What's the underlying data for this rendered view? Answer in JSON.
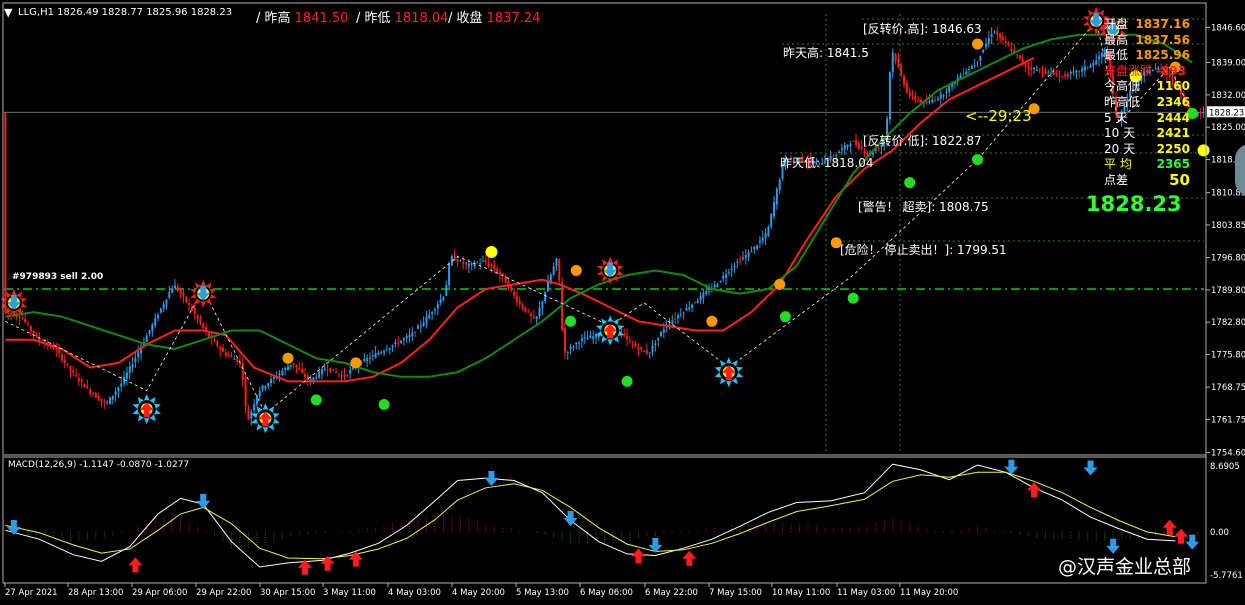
{
  "header": {
    "symbol_line": "LLG,H1  1826.49 1828.77 1825.96 1828.23",
    "top_labels": [
      {
        "text": "/ 昨高",
        "value": "1841.50"
      },
      {
        "text": "/ 昨低",
        "value": "1818.04"
      },
      {
        "text": "/ 收盘",
        "value": "1837.24"
      }
    ]
  },
  "chart_data": {
    "type": "candlestick",
    "timeframe": "H1",
    "ylim": [
      1754.5,
      1849.5
    ],
    "y_ticks": [
      1846.6,
      1839.0,
      1832.0,
      1825.0,
      1818.0,
      1810.85,
      1803.85,
      1796.8,
      1789.8,
      1782.8,
      1775.8,
      1768.75,
      1761.75,
      1754.6
    ],
    "current_price": "1828.23",
    "x_labels": [
      "27 Apr 2021",
      "28 Apr 13:00",
      "29 Apr 06:00",
      "29 Apr 22:00",
      "30 Apr 15:00",
      "3 May 11:00",
      "4 May 03:00",
      "4 May 20:00",
      "5 May 13:00",
      "6 May 06:00",
      "6 May 22:00",
      "7 May 15:00",
      "10 May 11:00",
      "11 May 03:00",
      "11 May 20:00"
    ],
    "price_path": [
      [
        0,
        1785
      ],
      [
        6,
        1784
      ],
      [
        12,
        1779
      ],
      [
        18,
        1777
      ],
      [
        24,
        1772
      ],
      [
        30,
        1768
      ],
      [
        36,
        1765
      ],
      [
        42,
        1770
      ],
      [
        48,
        1777
      ],
      [
        54,
        1784
      ],
      [
        60,
        1791
      ],
      [
        66,
        1786
      ],
      [
        72,
        1780
      ],
      [
        78,
        1776
      ],
      [
        84,
        1774
      ],
      [
        86,
        1761
      ],
      [
        90,
        1768
      ],
      [
        96,
        1771
      ],
      [
        102,
        1774
      ],
      [
        108,
        1770
      ],
      [
        114,
        1773
      ],
      [
        120,
        1771
      ],
      [
        126,
        1774
      ],
      [
        132,
        1776
      ],
      [
        138,
        1778
      ],
      [
        144,
        1780
      ],
      [
        150,
        1784
      ],
      [
        156,
        1789
      ],
      [
        158,
        1797
      ],
      [
        164,
        1795
      ],
      [
        170,
        1796
      ],
      [
        176,
        1793
      ],
      [
        182,
        1787
      ],
      [
        188,
        1783
      ],
      [
        194,
        1794
      ],
      [
        196,
        1797
      ],
      [
        198,
        1776
      ],
      [
        204,
        1779
      ],
      [
        210,
        1780
      ],
      [
        216,
        1782
      ],
      [
        222,
        1778
      ],
      [
        228,
        1776
      ],
      [
        234,
        1782
      ],
      [
        240,
        1785
      ],
      [
        246,
        1788
      ],
      [
        252,
        1791
      ],
      [
        258,
        1795
      ],
      [
        264,
        1798
      ],
      [
        270,
        1802
      ],
      [
        276,
        1818
      ],
      [
        282,
        1818
      ],
      [
        288,
        1817
      ],
      [
        294,
        1819
      ],
      [
        300,
        1822
      ],
      [
        306,
        1819
      ],
      [
        312,
        1822
      ],
      [
        314,
        1842
      ],
      [
        320,
        1832
      ],
      [
        326,
        1830
      ],
      [
        332,
        1832
      ],
      [
        338,
        1836
      ],
      [
        344,
        1839
      ],
      [
        350,
        1846
      ],
      [
        356,
        1842
      ],
      [
        362,
        1838
      ],
      [
        368,
        1837
      ],
      [
        374,
        1836
      ],
      [
        380,
        1837
      ],
      [
        386,
        1839
      ],
      [
        390,
        1842
      ],
      [
        394,
        1826
      ],
      [
        398,
        1832
      ],
      [
        404,
        1837
      ],
      [
        410,
        1838
      ],
      [
        416,
        1833
      ],
      [
        420,
        1828
      ]
    ],
    "series": [
      {
        "name": "",
        "color": "#ff2020",
        "values": [
          [
            0,
            1779
          ],
          [
            10,
            1779
          ],
          [
            20,
            1777
          ],
          [
            30,
            1773
          ],
          [
            40,
            1774
          ],
          [
            50,
            1778
          ],
          [
            60,
            1781
          ],
          [
            70,
            1781
          ],
          [
            78,
            1780
          ],
          [
            88,
            1773
          ],
          [
            100,
            1770
          ],
          [
            110,
            1770
          ],
          [
            120,
            1770
          ],
          [
            130,
            1771
          ],
          [
            140,
            1774
          ],
          [
            150,
            1779
          ],
          [
            160,
            1786
          ],
          [
            170,
            1790
          ],
          [
            180,
            1791
          ],
          [
            190,
            1792
          ],
          [
            196,
            1791
          ],
          [
            204,
            1789
          ],
          [
            214,
            1786
          ],
          [
            224,
            1783
          ],
          [
            234,
            1782
          ],
          [
            244,
            1781
          ],
          [
            254,
            1781
          ],
          [
            264,
            1785
          ],
          [
            274,
            1791
          ],
          [
            284,
            1801
          ],
          [
            294,
            1810
          ],
          [
            304,
            1816
          ],
          [
            314,
            1820
          ],
          [
            324,
            1826
          ],
          [
            334,
            1831
          ],
          [
            344,
            1834
          ],
          [
            354,
            1837
          ],
          [
            364,
            1840
          ]
        ]
      },
      {
        "name": "",
        "color": "#118a11",
        "values": [
          [
            0,
            1784
          ],
          [
            10,
            1785
          ],
          [
            20,
            1784
          ],
          [
            30,
            1782
          ],
          [
            40,
            1780
          ],
          [
            50,
            1778
          ],
          [
            60,
            1777
          ],
          [
            70,
            1779
          ],
          [
            80,
            1781
          ],
          [
            90,
            1781
          ],
          [
            100,
            1778
          ],
          [
            110,
            1775
          ],
          [
            120,
            1774
          ],
          [
            130,
            1772
          ],
          [
            140,
            1771
          ],
          [
            150,
            1771
          ],
          [
            160,
            1772
          ],
          [
            170,
            1775
          ],
          [
            180,
            1779
          ],
          [
            190,
            1783
          ],
          [
            200,
            1788
          ],
          [
            210,
            1791
          ],
          [
            220,
            1793
          ],
          [
            230,
            1794
          ],
          [
            240,
            1793
          ],
          [
            250,
            1790
          ],
          [
            260,
            1789
          ],
          [
            270,
            1790
          ],
          [
            280,
            1795
          ],
          [
            290,
            1805
          ],
          [
            300,
            1815
          ],
          [
            310,
            1822
          ],
          [
            320,
            1828
          ],
          [
            330,
            1833
          ],
          [
            340,
            1836
          ],
          [
            350,
            1839
          ],
          [
            360,
            1842
          ],
          [
            370,
            1844
          ],
          [
            380,
            1845
          ],
          [
            390,
            1845
          ],
          [
            400,
            1845
          ],
          [
            410,
            1843
          ],
          [
            420,
            1839
          ]
        ]
      }
    ],
    "horizontal_levels": [
      {
        "label": "[反转价.高]",
        "value": "1846.63"
      },
      {
        "label": "昨天高",
        "value": "1841.5"
      },
      {
        "label": "[反转价.低]",
        "value": "1822.87"
      },
      {
        "label": "昨天低",
        "value": "1818.04"
      },
      {
        "label": "[警告！ 超卖]",
        "value": "1808.75"
      },
      {
        "label": "[危险！ 停止卖出！]",
        "value": "1799.51"
      }
    ],
    "trade_line": {
      "label": "#979893 sell 2.00",
      "value": 1790
    },
    "countdown": "<--29:23",
    "signals": {
      "arrows_up": [
        [
          50,
          1764
        ],
        [
          92,
          1762
        ],
        [
          214,
          1781
        ],
        [
          256,
          1772
        ]
      ],
      "arrows_down": [
        [
          3,
          1787
        ],
        [
          70,
          1789
        ],
        [
          214,
          1794
        ],
        [
          386,
          1848
        ],
        [
          392,
          1846
        ]
      ],
      "orange_dots": [
        [
          100,
          1775
        ],
        [
          124,
          1774
        ],
        [
          202,
          1794
        ],
        [
          250,
          1783
        ],
        [
          274,
          1791
        ],
        [
          294,
          1800
        ],
        [
          344,
          1843
        ],
        [
          364,
          1829
        ],
        [
          414,
          1838
        ]
      ],
      "green_dots": [
        [
          110,
          1766
        ],
        [
          134,
          1765
        ],
        [
          200,
          1783
        ],
        [
          220,
          1770
        ],
        [
          276,
          1784
        ],
        [
          300,
          1788
        ],
        [
          320,
          1813
        ],
        [
          344,
          1818
        ],
        [
          420,
          1828
        ]
      ],
      "yellow_dots": [
        [
          172,
          1798
        ],
        [
          400,
          1836
        ],
        [
          424,
          1820
        ]
      ]
    },
    "macd": {
      "label": "MACD(12,26,9) -1.1147 -0.0870 -1.0277",
      "ylim": [
        -5.7761,
        8.6905
      ],
      "y_ticks": [
        "8.6905",
        "0.00",
        "-5.7761"
      ],
      "main_line": [
        [
          0,
          0.2
        ],
        [
          12,
          -0.9
        ],
        [
          24,
          -2.8
        ],
        [
          34,
          -3.6
        ],
        [
          44,
          -1.8
        ],
        [
          54,
          2.2
        ],
        [
          62,
          4.1
        ],
        [
          70,
          3.4
        ],
        [
          80,
          -1.2
        ],
        [
          90,
          -4.3
        ],
        [
          100,
          -3.8
        ],
        [
          112,
          -3.5
        ],
        [
          122,
          -2.6
        ],
        [
          132,
          -1.4
        ],
        [
          142,
          0.8
        ],
        [
          152,
          3.8
        ],
        [
          160,
          6.3
        ],
        [
          170,
          6.6
        ],
        [
          180,
          6.3
        ],
        [
          190,
          4.8
        ],
        [
          200,
          1.4
        ],
        [
          210,
          -1.2
        ],
        [
          220,
          -2.7
        ],
        [
          230,
          -2.9
        ],
        [
          240,
          -2.0
        ],
        [
          250,
          -0.9
        ],
        [
          260,
          0.7
        ],
        [
          270,
          2.4
        ],
        [
          280,
          3.6
        ],
        [
          292,
          3.8
        ],
        [
          304,
          4.8
        ],
        [
          314,
          8.3
        ],
        [
          324,
          7.6
        ],
        [
          334,
          6.4
        ],
        [
          344,
          8.2
        ],
        [
          354,
          7.3
        ],
        [
          364,
          5.4
        ],
        [
          374,
          3.9
        ],
        [
          384,
          1.8
        ],
        [
          394,
          0.4
        ],
        [
          404,
          -0.9
        ],
        [
          414,
          -1.1
        ]
      ],
      "signal_line": [
        [
          0,
          0.8
        ],
        [
          12,
          -0.1
        ],
        [
          24,
          -1.6
        ],
        [
          34,
          -2.6
        ],
        [
          44,
          -2.1
        ],
        [
          54,
          0.2
        ],
        [
          62,
          2.2
        ],
        [
          70,
          3.0
        ],
        [
          80,
          1.0
        ],
        [
          90,
          -2.0
        ],
        [
          100,
          -3.2
        ],
        [
          112,
          -3.3
        ],
        [
          122,
          -2.9
        ],
        [
          132,
          -2.1
        ],
        [
          142,
          -0.8
        ],
        [
          152,
          1.5
        ],
        [
          160,
          3.9
        ],
        [
          170,
          5.4
        ],
        [
          180,
          5.9
        ],
        [
          190,
          5.1
        ],
        [
          200,
          3.0
        ],
        [
          210,
          0.5
        ],
        [
          220,
          -1.5
        ],
        [
          230,
          -2.4
        ],
        [
          240,
          -2.2
        ],
        [
          250,
          -1.4
        ],
        [
          260,
          -0.2
        ],
        [
          270,
          1.2
        ],
        [
          280,
          2.5
        ],
        [
          292,
          3.2
        ],
        [
          304,
          4.0
        ],
        [
          314,
          6.2
        ],
        [
          324,
          7.0
        ],
        [
          334,
          6.7
        ],
        [
          344,
          7.3
        ],
        [
          354,
          7.3
        ],
        [
          364,
          6.2
        ],
        [
          374,
          4.8
        ],
        [
          384,
          3.0
        ],
        [
          394,
          1.4
        ],
        [
          404,
          0.0
        ],
        [
          414,
          -0.6
        ]
      ],
      "arrows_down": [
        [
          3,
          0.6
        ],
        [
          70,
          3.8
        ],
        [
          172,
          6.6
        ],
        [
          200,
          1.7
        ],
        [
          230,
          -1.6
        ],
        [
          356,
          8.0
        ],
        [
          384,
          7.9
        ],
        [
          392,
          -1.7
        ],
        [
          420,
          -1.2
        ]
      ],
      "arrows_up": [
        [
          46,
          -4.1
        ],
        [
          106,
          -4.4
        ],
        [
          114,
          -3.9
        ],
        [
          124,
          -3.4
        ],
        [
          224,
          -3.0
        ],
        [
          242,
          -3.3
        ],
        [
          364,
          5.1
        ],
        [
          412,
          0.5
        ],
        [
          416,
          -0.6
        ]
      ]
    }
  },
  "side_panel": {
    "rows": [
      {
        "label": "开盘",
        "value": "1837.16",
        "label_color": "#ffffff",
        "value_color": "#ff9900"
      },
      {
        "label": "最高",
        "value": "1837.56",
        "label_color": "#ffffff",
        "value_color": "#ff9900"
      },
      {
        "label": "最低",
        "value": "1825.96",
        "label_color": "#ffffff",
        "value_color": "#ff9900"
      },
      {
        "label": "开盘涨跌",
        "value": "-893",
        "label_color": "#ff2020",
        "value_color": "#ff2020"
      },
      {
        "label": "今高低",
        "value": "1160",
        "label_color": "#ffffff",
        "value_color": "#ffff00"
      },
      {
        "label": "昨高低",
        "value": "2346",
        "label_color": "#ffffff",
        "value_color": "#ffff00"
      },
      {
        "label": "5  天",
        "value": "2444",
        "label_color": "#ffffff",
        "value_color": "#ffff00"
      },
      {
        "label": "10 天",
        "value": "2421",
        "label_color": "#ffffff",
        "value_color": "#ffff00"
      },
      {
        "label": "20 天",
        "value": "2250",
        "label_color": "#ffffff",
        "value_color": "#ffff00"
      },
      {
        "label": "平  均",
        "value": "2365",
        "label_color": "#ffff00",
        "value_color": "#33ff33"
      },
      {
        "label": "点差",
        "value": "50",
        "label_color": "#ffffff",
        "value_color": "#ffff00"
      }
    ],
    "big_price": "1828.23"
  },
  "watermark": "@汉声金业总部",
  "colors": {
    "bull": "#2e9be6",
    "bear": "#ff1d1d",
    "grid": "#1f6b1f",
    "trade_line": "#17c417",
    "accent_orange": "#ff9900",
    "accent_yellow": "#ffff00",
    "signal_green": "#22dd22"
  }
}
